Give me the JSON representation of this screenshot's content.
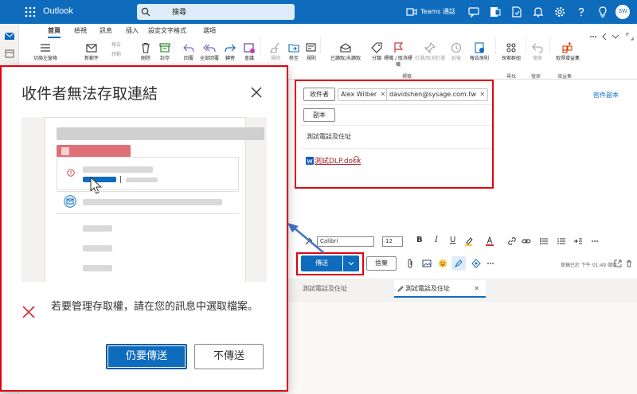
{
  "app": {
    "name": "Outlook"
  },
  "search": {
    "placeholder": "搜尋"
  },
  "topbar": {
    "teams_label": "Teams 通話",
    "avatar_initials": "SW"
  },
  "ribbon": {
    "tabs": [
      "首頁",
      "檢視",
      "訊息",
      "插入",
      "設定文字格式",
      "選項"
    ],
    "buttons": [
      {
        "label": "切換左窗格",
        "icon": "hamburger-icon"
      },
      {
        "label": "新郵件",
        "icon": "new-mail-icon"
      },
      {
        "label": "刪除",
        "icon": "delete-icon"
      },
      {
        "label": "封存",
        "icon": "archive-icon"
      },
      {
        "label": "回覆",
        "icon": "reply-icon"
      },
      {
        "label": "全部回覆",
        "icon": "reply-all-icon"
      },
      {
        "label": "轉寄",
        "icon": "forward-icon"
      },
      {
        "label": "會議",
        "icon": "meeting-icon"
      },
      {
        "label": "掃除",
        "icon": "sweep-icon"
      },
      {
        "label": "移至",
        "icon": "move-to-icon"
      },
      {
        "label": "規則",
        "icon": "rules-icon"
      },
      {
        "label": "已讀取/未讀取",
        "icon": "read-unread-icon"
      },
      {
        "label": "分類",
        "icon": "tag-icon"
      },
      {
        "label": "標幟 / 取消標幟",
        "icon": "flag-icon"
      },
      {
        "label": "釘選/取消釘選",
        "icon": "pin-icon"
      },
      {
        "label": "延後",
        "icon": "snooze-icon"
      },
      {
        "label": "報告原則",
        "icon": "report-policy-icon"
      },
      {
        "label": "探索群組",
        "icon": "discover-groups-icon"
      },
      {
        "label": "復原",
        "icon": "undo-icon"
      },
      {
        "label": "取得增益集",
        "icon": "get-addins-icon"
      }
    ],
    "small_labels": [
      "報告",
      "移動"
    ],
    "group_labels": [
      "標籤",
      "尋找",
      "復原",
      "增益集"
    ]
  },
  "compose": {
    "to_label": "收件者",
    "cc_label": "副本",
    "bcc_link": "密件副本",
    "recipients": [
      "Alex Wilber",
      "davidshen@sysage.com.tw"
    ],
    "subject": "測試電話及住址",
    "attachment": "測試DLP.docx"
  },
  "format_bar": {
    "font": "Calibri",
    "size": "12"
  },
  "send_row": {
    "send_label": "傳送",
    "discard_label": "捨棄",
    "draft_status": "草稿已於 下午 01:49 儲存"
  },
  "draft_tabs": [
    {
      "label": "測試電話及住址"
    },
    {
      "label": "測試電話及住址"
    }
  ],
  "dialog": {
    "title": "收件者無法存取連結",
    "message": "若要管理存取權，請在您的訊息中選取檔案。",
    "send_anyway": "仍要傳送",
    "dont_send": "不傳送"
  },
  "colors": {
    "brand": "#0f6cbd",
    "highlight_border": "#e3000f",
    "error_icon": "#d13438"
  }
}
